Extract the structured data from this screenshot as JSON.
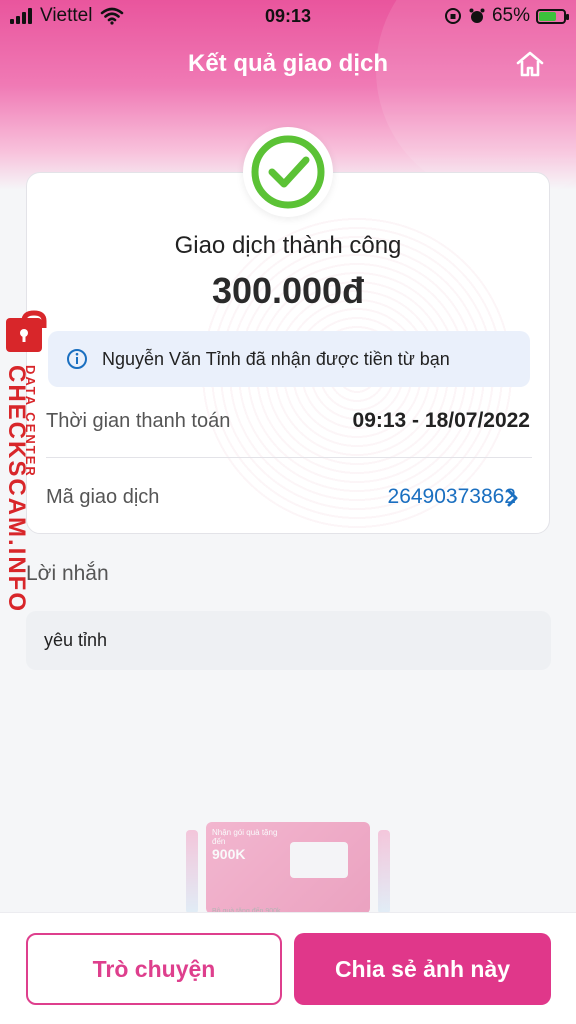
{
  "status_bar": {
    "carrier": "Viettel",
    "time": "09:13",
    "battery": "65%",
    "battery_level": 0.65
  },
  "header": {
    "title": "Kết quả giao dịch"
  },
  "result": {
    "status_text": "Giao dịch thành công",
    "amount": "300.000đ",
    "info_message": "Nguyễn Văn Tỉnh đã nhận được tiền từ bạn"
  },
  "details": {
    "payment_time_label": "Thời gian thanh toán",
    "payment_time_value": "09:13 - 18/07/2022",
    "transaction_id_label": "Mã giao dịch",
    "transaction_id_value": "26490373862"
  },
  "note": {
    "label": "Lời nhắn",
    "value": "yêu tỉnh"
  },
  "banner": {
    "line1": "Nhận gói quà tặng",
    "line2": "đến",
    "amount": "900K",
    "caption": "Bộ quà tặng đến 900k"
  },
  "watermark": {
    "line1": "DATA CENTER",
    "line2": "CHECKSCAM.INFO"
  },
  "actions": {
    "chat_label": "Trò chuyện",
    "share_label": "Chia sẻ ảnh này"
  },
  "colors": {
    "brand_pink": "#e0378a",
    "link_blue": "#1a6fc0",
    "success_green": "#5bc235",
    "watermark_red": "#d8262a"
  }
}
